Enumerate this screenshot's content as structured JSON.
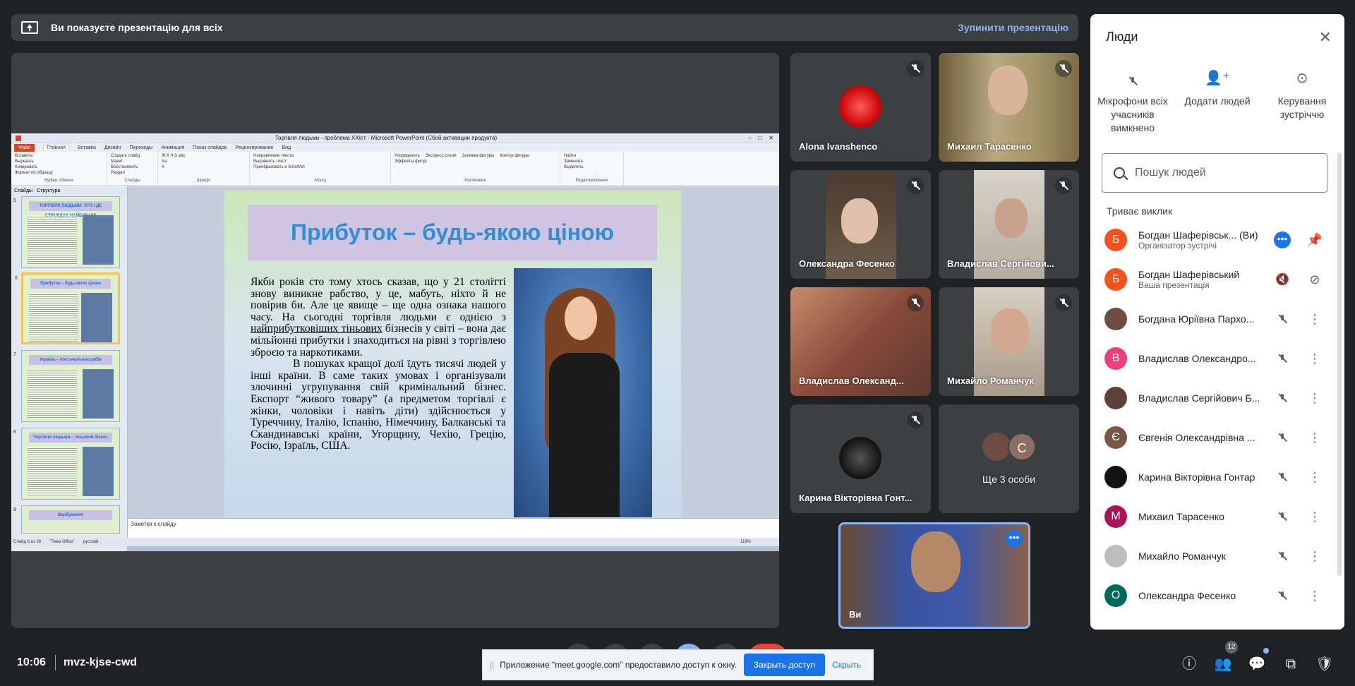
{
  "banner": {
    "message": "Ви показуєте презентацію для всіх",
    "stop_label": "Зупинити презентацію"
  },
  "ppt": {
    "window_title": "Торгівля людьми - проблема XXIст - Microsoft PowerPoint (Сбой активации продукта)",
    "tabs": [
      "Файл",
      "Главная",
      "Вставка",
      "Дизайн",
      "Переходы",
      "Анимация",
      "Показ слайдов",
      "Рецензирование",
      "Вид"
    ],
    "ribbon_groups": [
      {
        "name": "Буфер обмена",
        "items": [
          "Вставить",
          "Вырезать",
          "Копировать",
          "Формат по образцу"
        ]
      },
      {
        "name": "Слайды",
        "items": [
          "Создать слайд",
          "Макет",
          "Восстановить",
          "Раздел"
        ]
      },
      {
        "name": "Шрифт",
        "items": [
          "Ж К Ч S abc",
          "Aa",
          "A"
        ]
      },
      {
        "name": "Абзац",
        "items": [
          "Направление текста",
          "Выровнять текст",
          "Преобразовать в SmartArt"
        ]
      },
      {
        "name": "Рисование",
        "items": [
          "Упорядочить",
          "Экспресс-стили",
          "Заливка фигуры",
          "Контур фигуры",
          "Эффекты фигур"
        ]
      },
      {
        "name": "Редактирование",
        "items": [
          "Найти",
          "Заменить",
          "Выделить"
        ]
      }
    ],
    "thumb_tabs": [
      "Слайды",
      "Структура"
    ],
    "thumbnails": [
      {
        "num": "5",
        "title": "ТОРГІВЛЯ ЛЮДЬМИ: ХТО І ДЕ СТРАЖДАЄ НАЙБІЛЬШЕ"
      },
      {
        "num": "6",
        "title": "Прибуток – будь-якою ціною"
      },
      {
        "num": "7",
        "title": "Україна – постачальник рабів"
      },
      {
        "num": "8",
        "title": "Торгівля людьми – тіньовий бізнес"
      },
      {
        "num": "9",
        "title": "Вербування"
      }
    ],
    "slide": {
      "title": "Прибуток – будь-якою ціною",
      "para1_a": "Якби років сто тому хтось сказав, що у 21 столітті знову виникне рабство, у це, мабуть, ніхто й не повірив би. Але це явище – ще одна ознака нашого часу. На сьогодні торгівля людьми є однією з ",
      "para1_u": "найприбутковіших тіньових",
      "para1_b": " бізнесів у світі – вона дає мільйонні прибутки і знаходиться на рівні з торгівлею зброєю та наркотиками.",
      "para2": "В пошуках кращої долі їдуть тисячі людей у інші країни. В саме таких умовах і організували злочинні угрупування свій кримінальний бізнес. Експорт “живого товару” (а предметом торгівлі є жінки, чоловіки і навіть діти) здійснюється у Туреччину, Італію, Іспанію, Німеччину, Балканські та Скандинавські країни, Угорщину, Чехію, Грецію, Росію, Ізраїль, США."
    },
    "notes_placeholder": "Заметки к слайду",
    "status": [
      "Слайд 6 из 26",
      "\"Тема Office\"",
      "русский",
      "118%"
    ]
  },
  "tiles": [
    {
      "name": "Alona Ivanshenco",
      "avatar_color": "#d21a1a"
    },
    {
      "name": "Михаил Тарасенко"
    },
    {
      "name": "Олександра Фесенко"
    },
    {
      "name": "Владислав Сергійови..."
    },
    {
      "name": "Владислав Олександ..."
    },
    {
      "name": "Михайло Романчук"
    },
    {
      "name": "Карина Вікторівна Гонт..."
    },
    {
      "name": "Ще 3 особи",
      "extra_initial": "С"
    }
  ],
  "self_tile": {
    "name": "Ви"
  },
  "people_panel": {
    "title": "Люди",
    "actions": [
      {
        "icon": "mic-off-icon",
        "label": "Мікрофони всіх учасників вимкнено"
      },
      {
        "icon": "add-person-icon",
        "label": "Додати людей"
      },
      {
        "icon": "toggle-icon",
        "label": "Керування зустріччю"
      }
    ],
    "search_placeholder": "Пошук людей",
    "section": "Триває виклик",
    "participants": [
      {
        "initial": "Б",
        "color": "#f4511e",
        "name": "Богдан Шаферівськ... (Ви)",
        "sub": "Організатор зустрічі"
      },
      {
        "initial": "Б",
        "color": "#f4511e",
        "name": "Богдан Шаферівський",
        "sub": "Ваша презентація"
      },
      {
        "initial": "",
        "color": "#6d4c41",
        "name": "Богдана Юріївна Пархо...",
        "sub": ""
      },
      {
        "initial": "В",
        "color": "#ec407a",
        "name": "Владислав Олександро...",
        "sub": ""
      },
      {
        "initial": "",
        "color": "#5d4037",
        "name": "Владислав Сергійович Б...",
        "sub": ""
      },
      {
        "initial": "Є",
        "color": "#795548",
        "name": "Євгенія Олександрівна ...",
        "sub": ""
      },
      {
        "initial": "",
        "color": "#111111",
        "name": "Карина Вікторівна Гонтар",
        "sub": ""
      },
      {
        "initial": "М",
        "color": "#ad1457",
        "name": "Михаил Тарасенко",
        "sub": ""
      },
      {
        "initial": "",
        "color": "#bdbdbd",
        "name": "Михайло Романчук",
        "sub": ""
      },
      {
        "initial": "О",
        "color": "#00695c",
        "name": "Олександра Фесенко",
        "sub": ""
      }
    ]
  },
  "bottom": {
    "time": "10:06",
    "meeting_code": "mvz-kjse-cwd",
    "participant_count": "12",
    "share_msg": "Приложение \"meet.google.com\" предоставило доступ к окну.",
    "share_stop": "Закрыть доступ",
    "share_hide": "Скрыть"
  }
}
